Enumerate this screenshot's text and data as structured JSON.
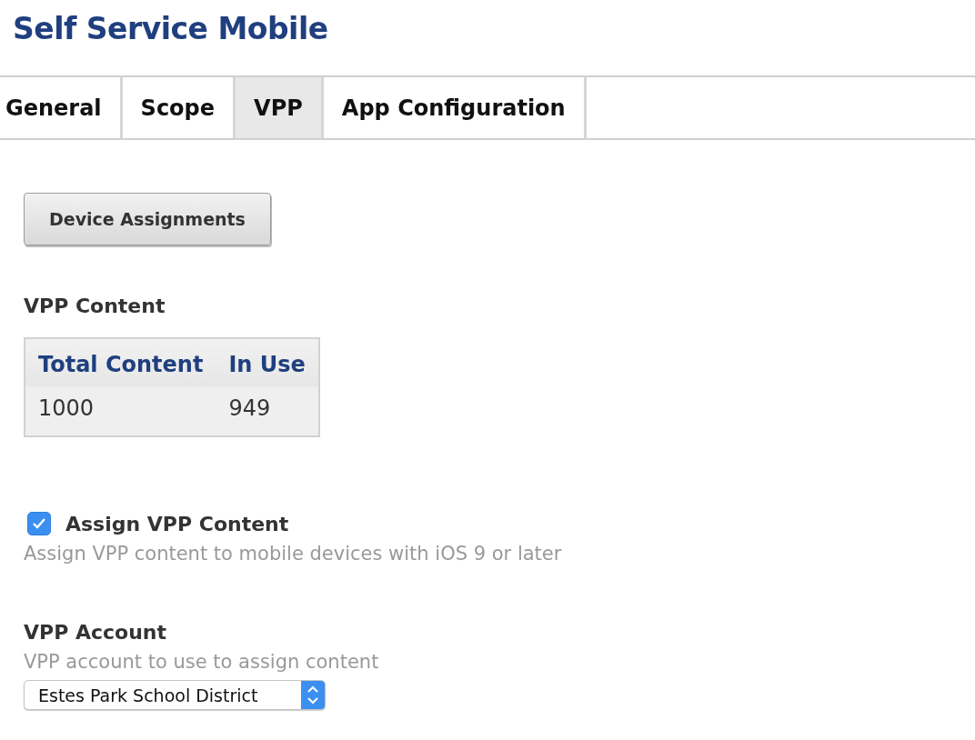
{
  "page": {
    "title": "Self Service Mobile"
  },
  "tabs": [
    {
      "label": "General",
      "selected": false
    },
    {
      "label": "Scope",
      "selected": false
    },
    {
      "label": "VPP",
      "selected": true
    },
    {
      "label": "App Configuration",
      "selected": false
    }
  ],
  "device_assignments_button": "Device Assignments",
  "vpp_content": {
    "heading": "VPP Content",
    "columns": [
      "Total Content",
      "In Use"
    ],
    "rows": [
      [
        "1000",
        "949"
      ]
    ]
  },
  "assign_vpp_content": {
    "label": "Assign VPP Content",
    "checked": true,
    "help": "Assign VPP content to mobile devices with iOS 9 or later"
  },
  "vpp_account": {
    "label": "VPP Account",
    "help": "VPP account to use to assign content",
    "value": "Estes Park School District"
  }
}
